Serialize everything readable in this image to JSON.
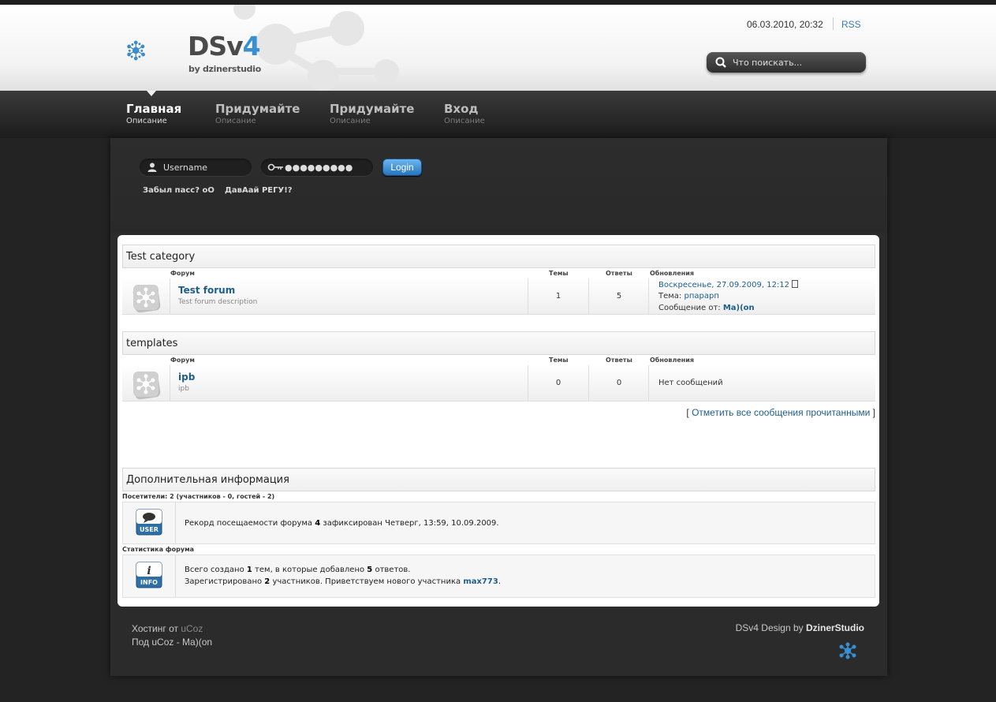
{
  "header": {
    "logo_text": "DSv",
    "logo_num": "4",
    "logo_sub": "by dzinerstudio",
    "datetime": "06.03.2010, 20:32",
    "rss": "RSS",
    "search_placeholder": "Что поискать..."
  },
  "nav": {
    "items": [
      {
        "title": "Главная",
        "desc": "Описание"
      },
      {
        "title": "Придумайте",
        "desc": "Описание"
      },
      {
        "title": "Придумайте",
        "desc": "Описание"
      },
      {
        "title": "Вход",
        "desc": "Описание"
      }
    ]
  },
  "login": {
    "username_placeholder": "Username",
    "password_value": "●●●●●●●●●",
    "button": "Login",
    "forgot": "Забыл пасс? оО",
    "register": "ДавАай РЕГУ!?"
  },
  "columns": {
    "forum": "Форум",
    "topics": "Темы",
    "replies": "Ответы",
    "updates": "Обновления"
  },
  "categories": [
    {
      "name": "Test category",
      "forum": {
        "title": "Test forum",
        "desc": "Test forum description",
        "topics": "1",
        "replies": "5",
        "last_date": "Воскресенье, 27.09.2009, 12:12",
        "topic_label": "Тема:",
        "topic": "рпарарп",
        "from_label": "Сообщение от:",
        "from": "Ma)(on"
      }
    },
    {
      "name": "templates",
      "forum": {
        "title": "ipb",
        "desc": "ipb",
        "topics": "0",
        "replies": "0",
        "no_posts": "Нет сообщений"
      }
    }
  ],
  "mark_read": {
    "open": "[",
    "link": "Отметить все сообщения прочитанными",
    "close": "]"
  },
  "info": {
    "title": "Дополнительная информация",
    "visitors_label": "Посетители: 2  (участников - 0, гостей - 2)",
    "record_pre": "Рекорд посещаемости форума",
    "record_num": "4",
    "record_post": "зафиксирован Четверг, 13:59, 10.09.2009.",
    "user_icon_text": "USER",
    "stats_label": "Статистика форума",
    "stats_line1_pre": "Всего создано",
    "stats_topics": "1",
    "stats_line1_mid": "тем, в которые добавлено",
    "stats_replies": "5",
    "stats_line1_post": "ответов.",
    "stats_line2_pre": "Зарегистрировано",
    "stats_members": "2",
    "stats_line2_mid": "участников. Приветствуем нового участника",
    "stats_newest": "max773",
    "stats_line2_post": ".",
    "info_icon_text": "INFO"
  },
  "footer": {
    "hosting_label": "Хостинг от",
    "hosting_link": "uCoz",
    "under": "Под uCoz - Ma)(on",
    "design_label": "DSv4 Design by",
    "design_by": "DzinerStudio"
  },
  "colors": {
    "accent": "#1d5e8e",
    "logo_blue": "#3a8fd0",
    "background": "#232323"
  }
}
